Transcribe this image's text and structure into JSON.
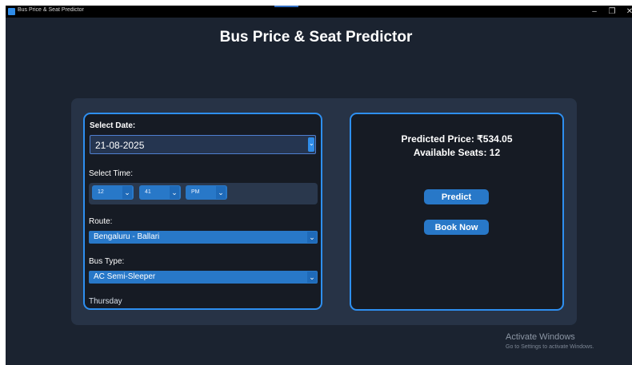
{
  "window": {
    "title": "Bus Price & Seat Predictor",
    "controls": {
      "minimize": "–",
      "maximize": "❐",
      "close": "✕"
    }
  },
  "app": {
    "title": "Bus Price & Seat Predictor"
  },
  "form": {
    "date_label": "Select Date:",
    "date_value": "21-08-2025",
    "time_label": "Select Time:",
    "hour": "12",
    "minute": "41",
    "ampm": "PM",
    "route_label": "Route:",
    "route_value": "Bengaluru - Ballari",
    "bus_type_label": "Bus Type:",
    "bus_type_value": "AC Semi-Sleeper",
    "day_of_week": "Thursday"
  },
  "result": {
    "price_text": "Predicted Price: ₹534.05",
    "seats_text": "Available Seats: 12"
  },
  "buttons": {
    "predict": "Predict",
    "book": "Book Now"
  },
  "watermark": {
    "line1": "Activate Windows",
    "line2": "Go to Settings to activate Windows."
  },
  "colors": {
    "accent": "#2f8ce8",
    "background": "#1b2330",
    "card": "#161b24",
    "button": "#2878c8"
  },
  "icons": {
    "dropdown": "chevron-down-icon",
    "app": "app-icon"
  }
}
